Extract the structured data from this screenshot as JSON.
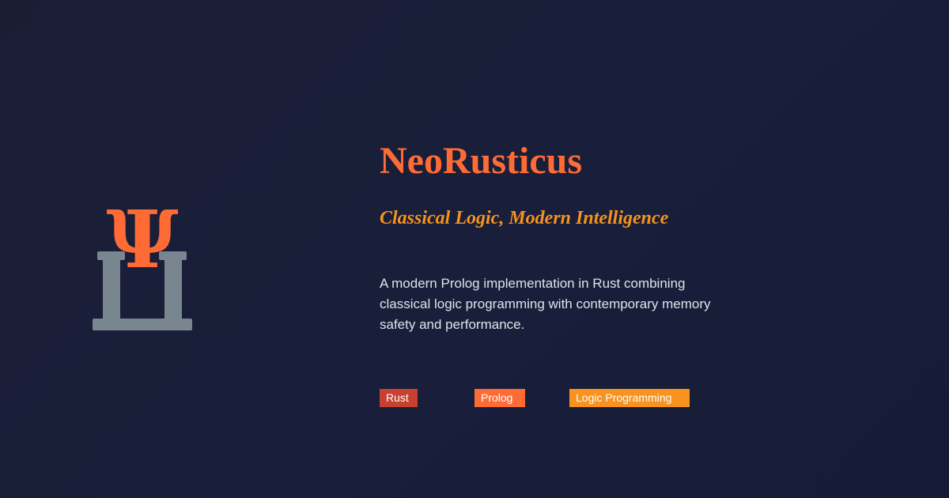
{
  "logo": {
    "icon": "psi-pillars-icon",
    "glyph": "Ψ"
  },
  "title": "NeoRusticus",
  "subtitle": "Classical Logic, Modern Intelligence",
  "description": "A modern Prolog implementation in Rust combining classical logic programming with contemporary memory safety and performance.",
  "tags": [
    {
      "label": "Rust",
      "color": "#c8412f"
    },
    {
      "label": "Prolog",
      "color": "#ff6b35"
    },
    {
      "label": "Logic Programming",
      "color": "#f7931e"
    }
  ],
  "colors": {
    "background": "#1a1e38",
    "accent": "#ff6b35",
    "accent_secondary": "#f7931e",
    "pillar": "#7a868f",
    "text": "#dfe3ea"
  }
}
